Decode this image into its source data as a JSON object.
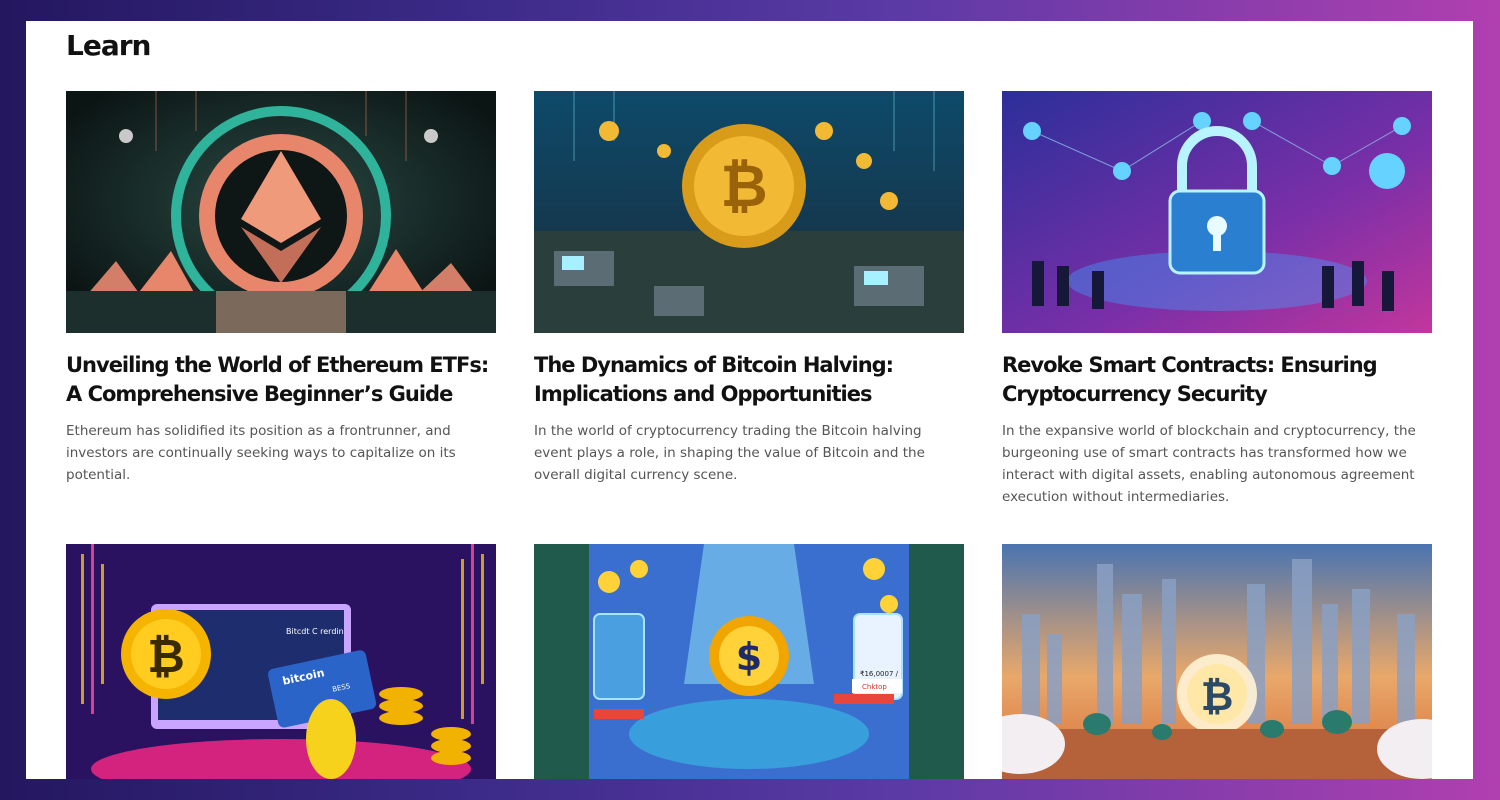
{
  "section": {
    "title": "Learn"
  },
  "cards": [
    {
      "image": "ethereum-logo-illustration",
      "title": "Unveiling the World of Ethereum ETFs: A Comprehensive Beginner’s Guide",
      "description": "Ethereum has solidified its position as a frontrunner, and investors are continually seeking ways to capitalize on its potential."
    },
    {
      "image": "bitcoin-halving-illustration",
      "title": "The Dynamics of Bitcoin Halving: Implications and Opportunities",
      "description": "In the world of cryptocurrency trading the Bitcoin halving event plays a role, in shaping the value of Bitcoin and the overall digital currency scene."
    },
    {
      "image": "smart-contract-lock-illustration",
      "title": "Revoke Smart Contracts: Ensuring Cryptocurrency Security",
      "description": "In the expansive world of blockchain and cryptocurrency, the burgeoning use of smart contracts has transformed how we interact with digital assets, enabling autonomous agreement execution without intermediaries."
    },
    {
      "image": "bitcoin-credit-card-illustration",
      "image_text": [
        "Bitcdt C rerdin",
        "bitcoin",
        "BESS"
      ]
    },
    {
      "image": "crypto-payments-illustration",
      "image_text": [
        "Chktop",
        "₹16,0007 /"
      ]
    },
    {
      "image": "bitcoin-city-skyline-illustration"
    }
  ]
}
